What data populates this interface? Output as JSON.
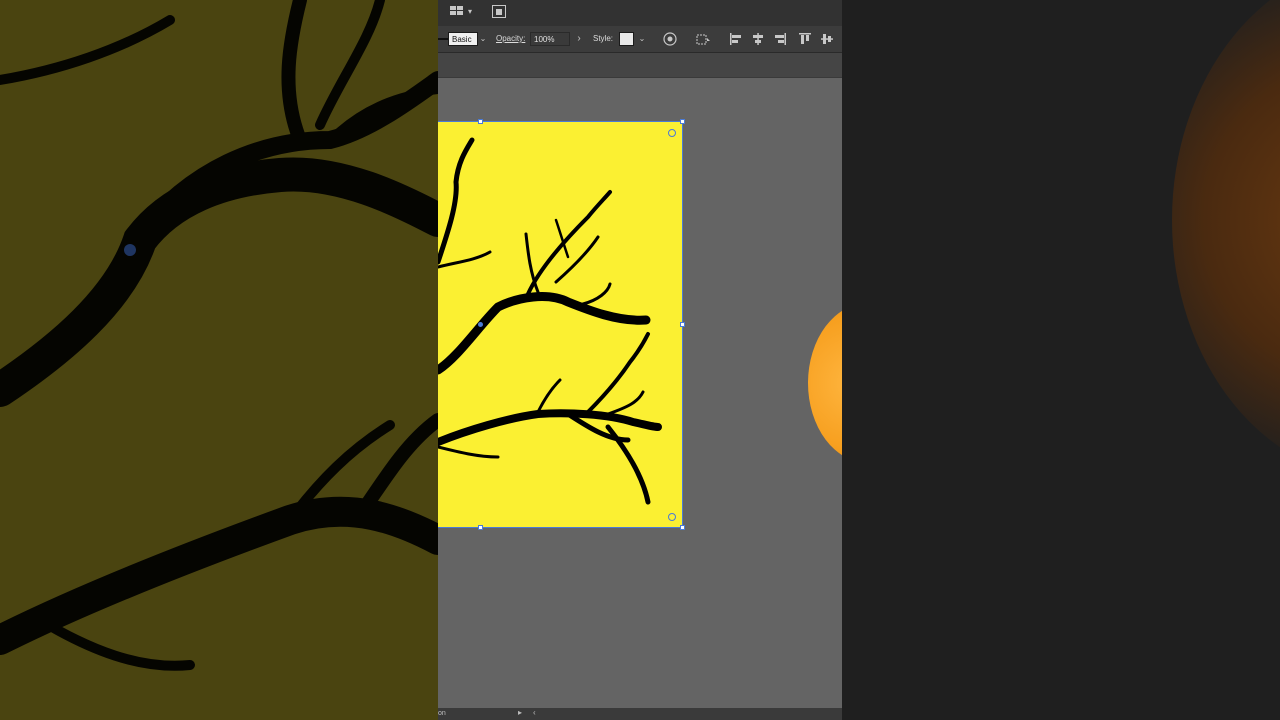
{
  "control_bar": {
    "stroke_profile": "Basic",
    "opacity_label": "Opacity:",
    "opacity_value": "100%",
    "style_label": "Style:"
  },
  "status_bar": {
    "left_text": "on"
  },
  "icons": {
    "workspace_switcher": "workspace-grid-icon",
    "arrange_documents": "arrange-documents-icon",
    "recolor": "recolor-artwork-icon",
    "transform": "transform-icon",
    "align_left": "align-left-icon",
    "align_center": "align-center-icon",
    "align_right": "align-right-icon",
    "align_top": "align-top-icon",
    "align_middle": "align-vertical-center-icon"
  },
  "colors": {
    "artboard_fill": "#fbf032",
    "branch_color": "#000000",
    "sun_color": "#f7a020",
    "selection_color": "#4a7bd6"
  }
}
